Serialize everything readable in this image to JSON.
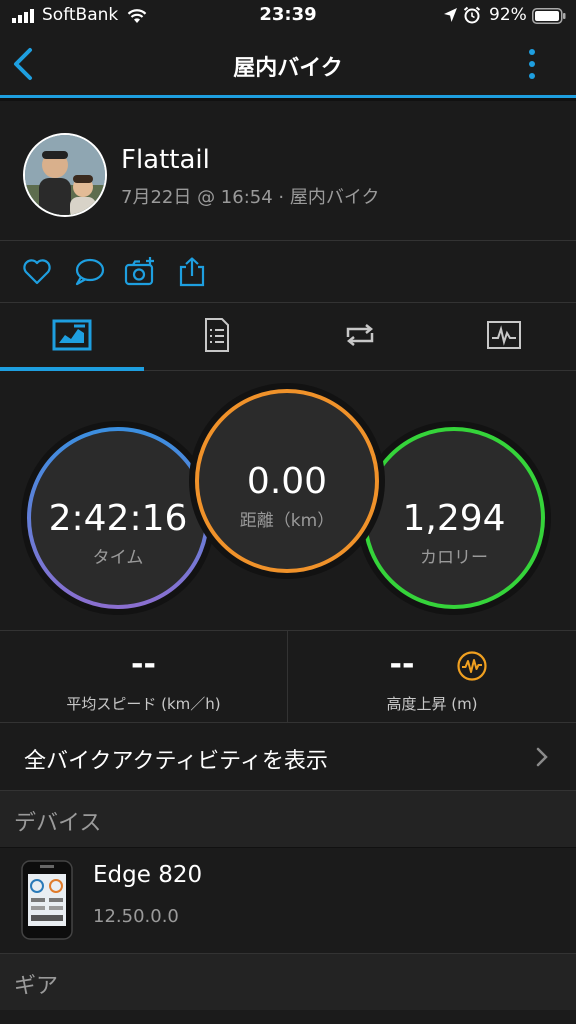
{
  "status_bar": {
    "carrier": "SoftBank",
    "time": "23:39",
    "battery": "92%"
  },
  "nav": {
    "title": "屋内バイク"
  },
  "profile": {
    "name": "Flattail",
    "meta": "7月22日 @ 16:54 · 屋内バイク"
  },
  "metrics": {
    "time": {
      "value": "2:42:16",
      "label": "タイム"
    },
    "distance": {
      "value": "0.00",
      "label": "距離（km）"
    },
    "calories": {
      "value": "1,294",
      "label": "カロリー"
    }
  },
  "stats": {
    "avg_speed": {
      "value": "--",
      "label": "平均スピード (km／h)"
    },
    "elevation": {
      "value": "--",
      "label": "高度上昇 (m)"
    }
  },
  "show_all": {
    "label": "全バイクアクティビティを表示"
  },
  "devices_section": {
    "label": "デバイス"
  },
  "device": {
    "name": "Edge 820",
    "version": "12.50.0.0"
  },
  "gear_section": {
    "label": "ギア"
  },
  "colors": {
    "accent": "#1e9fe0",
    "time_ring_top": "#3b8fe0",
    "time_ring_bottom": "#8b6fd0",
    "distance_ring": "#f0922a",
    "calories_ring": "#35d43a",
    "elevation_icon": "#f0a020"
  },
  "icons": {
    "actions": [
      "heart-icon",
      "comment-icon",
      "add-photo-icon",
      "share-icon"
    ],
    "tabs": [
      "stats-chart-icon",
      "details-list-icon",
      "laps-icon",
      "graph-icon"
    ]
  }
}
